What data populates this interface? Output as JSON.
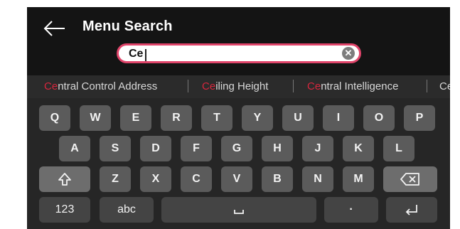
{
  "header": {
    "title": "Menu Search",
    "back_icon": "arrow-left-icon"
  },
  "search": {
    "value": "Ce",
    "clear_icon": "clear-icon",
    "accent_color": "#e0446a"
  },
  "suggestions": [
    {
      "highlight": "Ce",
      "rest": "ntral Control Address"
    },
    {
      "highlight": "Ce",
      "rest": "iling Height"
    },
    {
      "highlight": "Ce",
      "rest": "ntral Intelligence"
    },
    {
      "highlight": "Ce",
      "rest": ""
    }
  ],
  "keyboard": {
    "row1": [
      "Q",
      "W",
      "E",
      "R",
      "T",
      "Y",
      "U",
      "I",
      "O",
      "P"
    ],
    "row2": [
      "A",
      "S",
      "D",
      "F",
      "G",
      "H",
      "J",
      "K",
      "L"
    ],
    "row3": [
      "Z",
      "X",
      "C",
      "V",
      "B",
      "N",
      "M"
    ],
    "shift_icon": "shift-icon",
    "delete_icon": "backspace-icon",
    "numbers_label": "123",
    "letters_label": "abc",
    "space_icon": "space-icon",
    "dot_label": "·",
    "enter_icon": "enter-icon"
  },
  "colors": {
    "highlight": "#d7263d",
    "background": "#1b1b1b"
  }
}
